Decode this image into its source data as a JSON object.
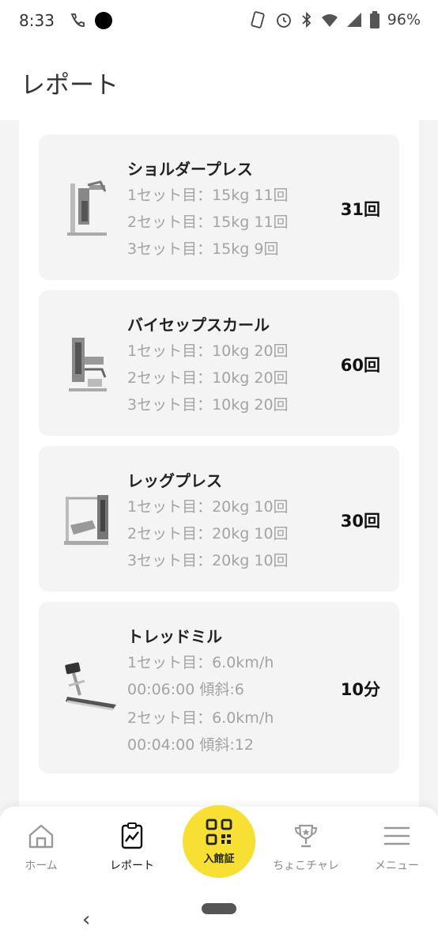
{
  "status_bar": {
    "time": "8:33",
    "battery": "96%",
    "icons": [
      "wifi-calling-icon",
      "circle-dot-icon",
      "nfc-icon",
      "alarm-icon",
      "bluetooth-icon",
      "wifi-icon",
      "signal-icon",
      "battery-icon"
    ]
  },
  "header": {
    "title": "レポート"
  },
  "reports": [
    {
      "name": "ショルダープレス",
      "sets": [
        "1セット目：15kg 11回",
        "2セット目：15kg 11回",
        "3セット目：15kg 9回"
      ],
      "total": "31回",
      "icon": "shoulder-press-machine-icon"
    },
    {
      "name": "バイセップスカール",
      "sets": [
        "1セット目：10kg 20回",
        "2セット目：10kg 20回",
        "3セット目：10kg 20回"
      ],
      "total": "60回",
      "icon": "biceps-curl-machine-icon"
    },
    {
      "name": "レッグプレス",
      "sets": [
        "1セット目：20kg 10回",
        "2セット目：20kg 10回",
        "3セット目：20kg 10回"
      ],
      "total": "30回",
      "icon": "leg-press-machine-icon"
    },
    {
      "name": "トレッドミル",
      "sets": [
        "1セット目：6.0km/h",
        "00:06:00 傾斜:6",
        "2セット目：6.0km/h",
        "00:04:00 傾斜:12"
      ],
      "total": "10分",
      "icon": "treadmill-icon"
    }
  ],
  "tabbar": {
    "home": "ホーム",
    "report": "レポート",
    "qr": "入館証",
    "challenge": "ちょこチャレ",
    "menu": "メニュー",
    "accent": "#f7e033"
  },
  "navbar": {
    "back": "‹"
  }
}
